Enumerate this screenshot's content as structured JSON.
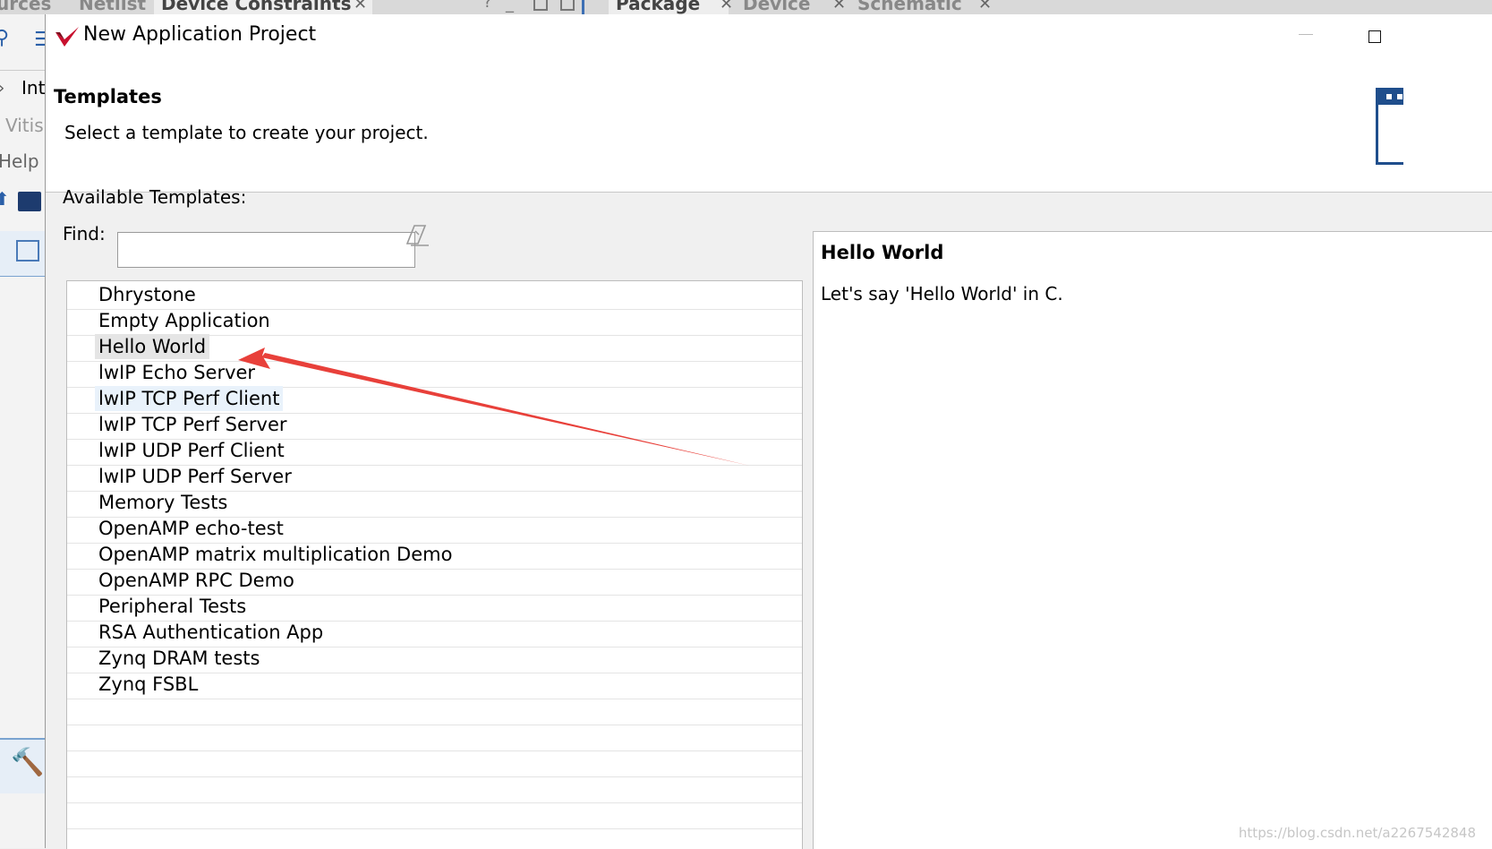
{
  "background_ide": {
    "tabs": [
      "urces",
      "Netlist",
      "Device Constraints",
      "Package",
      "Device",
      "Schematic"
    ],
    "left_items": [
      "Inte",
      "Vitis",
      "Help"
    ]
  },
  "dialog": {
    "title": "New Application Project",
    "page_title": "Templates",
    "page_subtitle": "Select a template to create your project.",
    "available_label": "Available Templates:",
    "find_label": "Find:",
    "find_value": "",
    "templates": [
      "Dhrystone",
      "Empty Application",
      "Hello World",
      "lwIP Echo Server",
      "lwIP TCP Perf Client",
      "lwIP TCP Perf Server",
      "lwIP UDP Perf Client",
      "lwIP UDP Perf Server",
      "Memory Tests",
      "OpenAMP echo-test",
      "OpenAMP matrix multiplication Demo",
      "OpenAMP RPC Demo",
      "Peripheral Tests",
      "RSA Authentication App",
      "Zynq DRAM tests",
      "Zynq FSBL"
    ],
    "selected_template": "Hello World",
    "description": {
      "title": "Hello World",
      "text": "Let's say 'Hello World' in C."
    }
  },
  "watermark": "https://blog.csdn.net/a2267542848",
  "colors": {
    "annotation_arrow": "#e8403a",
    "logo_red": "#c8102e",
    "selection": "#e5e5e5",
    "hover": "#e9f2fb"
  }
}
